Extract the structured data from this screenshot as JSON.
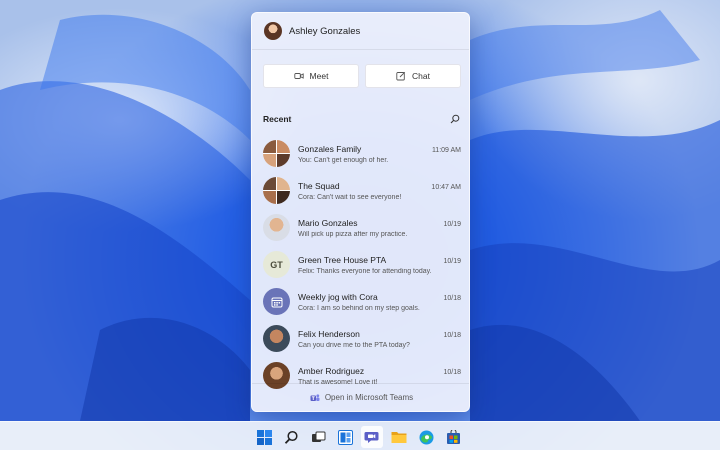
{
  "user": {
    "name": "Ashley Gonzales"
  },
  "buttons": {
    "meet": "Meet",
    "chat": "Chat"
  },
  "recent": {
    "label": "Recent"
  },
  "conversations": [
    {
      "name": "Gonzales Family",
      "time": "11:09 AM",
      "preview": "You: Can't get enough of her."
    },
    {
      "name": "The Squad",
      "time": "10:47 AM",
      "preview": "Cora: Can't wait to see everyone!"
    },
    {
      "name": "Mario Gonzales",
      "time": "10/19",
      "preview": "Will pick up pizza after my practice."
    },
    {
      "name": "Green Tree House PTA",
      "time": "10/19",
      "preview": "Felix: Thanks everyone for attending today.",
      "initials": "GT"
    },
    {
      "name": "Weekly jog with Cora",
      "time": "10/18",
      "preview": "Cora: I am so behind on my step goals."
    },
    {
      "name": "Felix Henderson",
      "time": "10/18",
      "preview": "Can you drive me to the PTA today?"
    },
    {
      "name": "Amber Rodriguez",
      "time": "10/18",
      "preview": "That is awesome! Love it!"
    }
  ],
  "footer": {
    "label": "Open in Microsoft Teams"
  },
  "colors": {
    "accent": "#5b5fc7",
    "wallpaper_blue": "#2a66e8"
  }
}
